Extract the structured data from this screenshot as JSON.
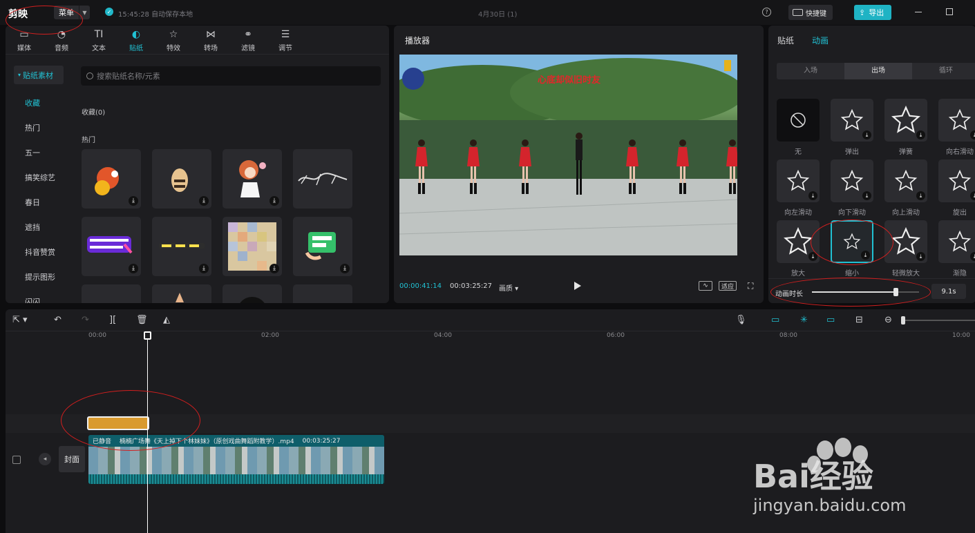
{
  "topbar": {
    "app_name": "剪映",
    "menu_label": "菜单",
    "save_status": "15:45:28 自动保存本地",
    "doc_title": "4月30日 (1)",
    "shortcut_label": "快捷键",
    "export_label": "导出"
  },
  "media_toolbar": [
    {
      "label": "媒体",
      "icon": "media-icon",
      "glyph": "▭"
    },
    {
      "label": "音频",
      "icon": "audio-icon",
      "glyph": "◔"
    },
    {
      "label": "文本",
      "icon": "text-icon",
      "glyph": "TI"
    },
    {
      "label": "贴纸",
      "icon": "sticker-icon",
      "glyph": "◐"
    },
    {
      "label": "特效",
      "icon": "effects-icon",
      "glyph": "☆"
    },
    {
      "label": "转场",
      "icon": "transition-icon",
      "glyph": "⋈"
    },
    {
      "label": "滤镜",
      "icon": "filter-icon",
      "glyph": "⚭"
    },
    {
      "label": "调节",
      "icon": "adjust-icon",
      "glyph": "☰"
    }
  ],
  "active_tool": "贴纸",
  "sticker_nav": {
    "category": "贴纸素材",
    "items": [
      "收藏",
      "热门",
      "五一",
      "搞笑综艺",
      "春日",
      "遮挡",
      "抖音赞赏",
      "提示图形",
      "闪闪"
    ]
  },
  "sticker_search_placeholder": "搜索贴纸名称/元素",
  "favorites_label": "收藏(0)",
  "hot_label": "热门",
  "player": {
    "title": "播放器",
    "video_banner": "心底却似旧时友",
    "current_time": "00:00:41:14",
    "duration": "00:03:25:27",
    "quality": "画质",
    "fit_label": "适应"
  },
  "right_panel": {
    "tabs": [
      "贴纸",
      "动画"
    ],
    "segments": [
      "入场",
      "出场",
      "循环"
    ],
    "active_segment": "出场",
    "animations": [
      "无",
      "弹出",
      "弹簧",
      "向右滑动",
      "向左滑动",
      "向下滑动",
      "向上滑动",
      "旋出",
      "放大",
      "缩小",
      "轻微放大",
      "渐隐"
    ],
    "selected_animation": "缩小",
    "duration_label": "动画时长",
    "duration_value": "9.1s",
    "duration_fraction": 0.78
  },
  "timeline": {
    "ruler": [
      "00:00",
      "02:00",
      "04:00",
      "06:00",
      "08:00",
      "10:00"
    ],
    "cover_label": "封面",
    "clip": {
      "muted": "已静音",
      "name": "楠楠广场舞《天上掉下个林妹妹》（原创戏曲舞蹈附教学）.mp4",
      "duration": "00:03:25:27"
    }
  },
  "watermark": {
    "brand": "Bai经验",
    "url": "jingyan.baidu.com"
  },
  "colors": {
    "accent": "#21c1d3",
    "annotation": "#d21f1f",
    "sticker_clip": "#d99a2e"
  }
}
